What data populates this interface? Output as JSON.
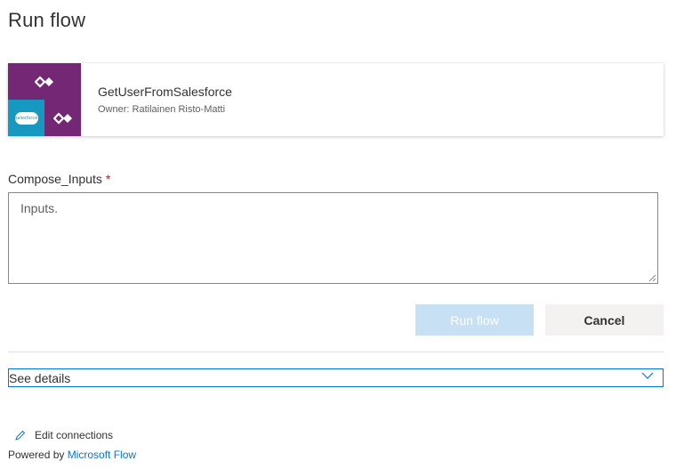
{
  "page": {
    "title": "Run flow"
  },
  "flow": {
    "name": "GetUserFromSalesforce",
    "owner": "Owner: Ratilainen Risto-Matti",
    "connector_label": "salesforce",
    "colors": {
      "flow_purple": "#742774",
      "salesforce_blue": "#1798c1"
    }
  },
  "form": {
    "field_label": "Compose_Inputs",
    "required_marker": "*",
    "field_value": "Inputs."
  },
  "actions": {
    "run_label": "Run flow",
    "cancel_label": "Cancel"
  },
  "details": {
    "label": "See details"
  },
  "footer": {
    "edit_connections": "Edit connections",
    "powered_by": "Powered by",
    "powered_link": "Microsoft Flow"
  },
  "colors": {
    "accent": "#0078d4",
    "run_button_disabled": "#c7e0f4",
    "required": "#a4262c"
  }
}
